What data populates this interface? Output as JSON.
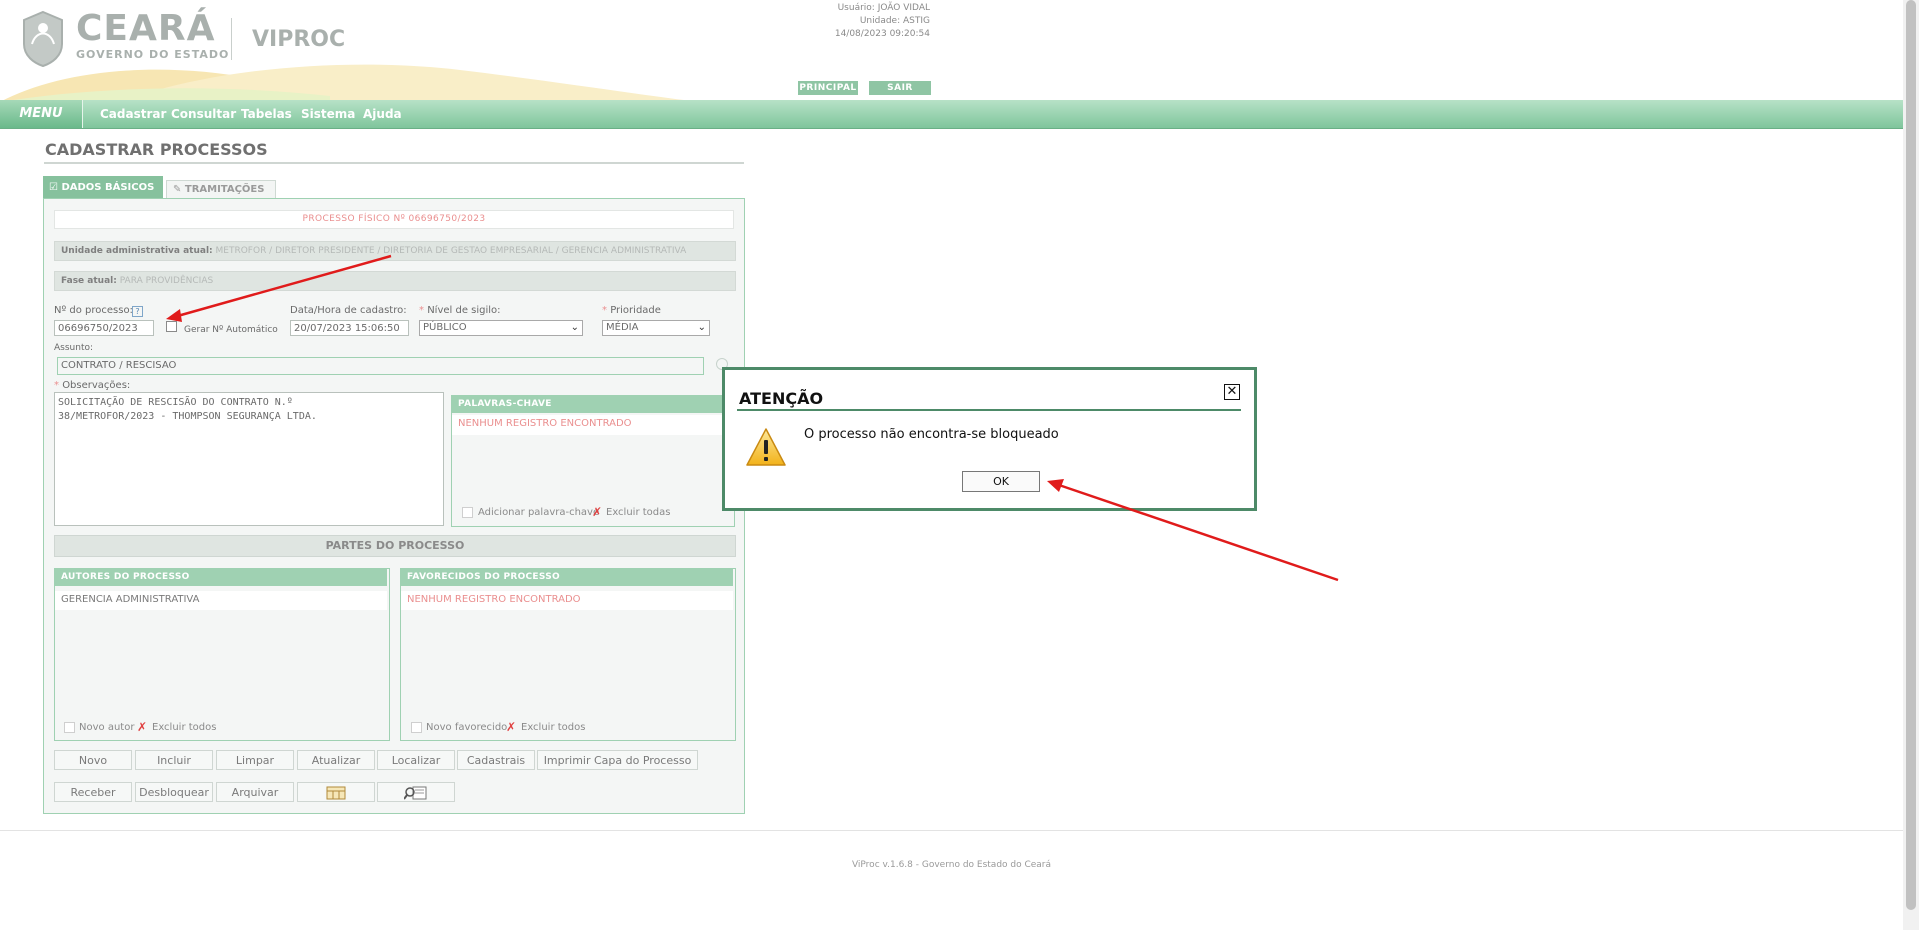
{
  "header": {
    "logo_title": "CEARÁ",
    "logo_subtitle": "GOVERNO DO ESTADO",
    "app_name": "VIPROC",
    "user_label": "Usuário:",
    "user_value": "JOÃO VIDAL",
    "unit_label": "Unidade:",
    "unit_value": "ASTIG",
    "datetime": "14/08/2023 09:20:54",
    "principal_label": "PRINCIPAL",
    "sair_label": "SAIR"
  },
  "menu": {
    "label": "MENU",
    "items": [
      "Cadastrar",
      "Consultar",
      "Tabelas",
      "Sistema",
      "Ajuda"
    ]
  },
  "page": {
    "title": "CADASTRAR PROCESSOS",
    "tabs": [
      "DADOS BÁSICOS",
      "TRAMITAÇÕES"
    ]
  },
  "form": {
    "processo_fisico": "PROCESSO FÍSICO Nº 06696750/2023",
    "unidade_label": "Unidade administrativa atual:",
    "unidade_value": "METROFOR / DIRETOR PRESIDENTE / DIRETORIA DE GESTAO EMPRESARIAL / GERENCIA ADMINISTRATIVA",
    "fase_label": "Fase atual:",
    "fase_value": "PARA PROVIDÊNCIAS",
    "num_processo_label": "Nº do processo:",
    "help_label": "?",
    "num_processo_value": "06696750/2023",
    "gerar_auto_label": "Gerar Nº Automático",
    "data_hora_label": "Data/Hora de cadastro:",
    "data_hora_value": "20/07/2023 15:06:50",
    "sigilo_label": "Nível de sigilo:",
    "sigilo_value": "PÚBLICO",
    "prioridade_label": "Prioridade",
    "prioridade_value": "MÉDIA",
    "assunto_label": "Assunto:",
    "assunto_value": "CONTRATO / RESCISAO",
    "obs_label": "Observações:",
    "obs_value": "SOLICITAÇÃO DE RESCISÃO DO CONTRATO N.º\n38/METROFOR/2023 - THOMPSON SEGURANÇA LTDA."
  },
  "palavras": {
    "title": "PALAVRAS-CHAVE",
    "empty": "NENHUM REGISTRO ENCONTRADO",
    "add_label": "Adicionar palavra-chave",
    "remove_all_label": "Excluir todas"
  },
  "partes": {
    "title": "PARTES DO PROCESSO",
    "autores_title": "AUTORES DO PROCESSO",
    "autores_rows": [
      "GERENCIA ADMINISTRATIVA"
    ],
    "novo_autor_label": "Novo autor",
    "excluir_autores_label": "Excluir todos",
    "favorecidos_title": "FAVORECIDOS DO PROCESSO",
    "favorecidos_empty": "NENHUM REGISTRO ENCONTRADO",
    "novo_favorecido_label": "Novo favorecido",
    "excluir_favorecidos_label": "Excluir todos"
  },
  "actions": {
    "row1": [
      "Novo",
      "Incluir",
      "Limpar",
      "Atualizar",
      "Localizar",
      "Cadastrais",
      "Imprimir Capa do Processo"
    ],
    "row2": [
      "Receber",
      "Desbloquear",
      "Arquivar"
    ]
  },
  "footer": {
    "text": "ViProc v.1.6.8 - Governo do Estado do Ceará"
  },
  "dialog": {
    "title": "ATENÇÃO",
    "message": "O processo não encontra-se bloqueado",
    "ok_label": "OK",
    "close_glyph": "✕",
    "icon": "warning-icon"
  },
  "colors": {
    "accent_green": "#86c19d",
    "dialog_border": "#4d8a68",
    "empty_text": "#ea8f8f",
    "annotation_arrow": "#e01b1b"
  }
}
